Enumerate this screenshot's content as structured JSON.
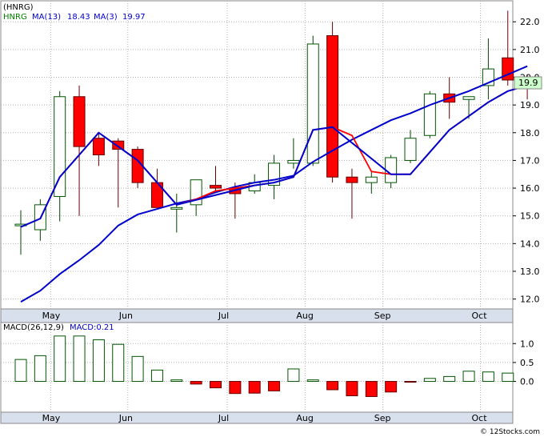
{
  "chart_data": [
    {
      "type": "candlestick",
      "title": "(HNRG)",
      "legend": [
        {
          "label": "HNRG",
          "color": "#008000"
        },
        {
          "label": "MA(13)",
          "value": "18.43",
          "color": "#0000cc"
        },
        {
          "label": "MA(3)",
          "value": "19.97",
          "color": "#0000cc"
        }
      ],
      "last_price_label": "19.9",
      "ylim": [
        11.7,
        22.7
      ],
      "yticks": [
        "12.0",
        "13.0",
        "14.0",
        "15.0",
        "16.0",
        "17.0",
        "18.0",
        "19.0",
        "20.0",
        "21.0",
        "22.0"
      ],
      "xticks": [
        "May",
        "Jun",
        "Jul",
        "Aug",
        "Sep",
        "Oct"
      ],
      "candles": [
        {
          "o": 14.7,
          "h": 15.2,
          "l": 13.6,
          "c": 14.7
        },
        {
          "o": 14.5,
          "h": 15.6,
          "l": 14.1,
          "c": 15.4
        },
        {
          "o": 15.7,
          "h": 19.5,
          "l": 14.8,
          "c": 19.3
        },
        {
          "o": 19.3,
          "h": 19.7,
          "l": 15.0,
          "c": 17.5
        },
        {
          "o": 17.8,
          "h": 18.0,
          "l": 16.8,
          "c": 17.2
        },
        {
          "o": 17.7,
          "h": 17.8,
          "l": 15.3,
          "c": 17.4
        },
        {
          "o": 17.4,
          "h": 17.5,
          "l": 16.0,
          "c": 16.2
        },
        {
          "o": 16.2,
          "h": 16.7,
          "l": 15.3,
          "c": 15.3
        },
        {
          "o": 15.3,
          "h": 15.8,
          "l": 14.4,
          "c": 15.3
        },
        {
          "o": 15.4,
          "h": 16.3,
          "l": 15.0,
          "c": 16.3
        },
        {
          "o": 16.1,
          "h": 16.8,
          "l": 15.9,
          "c": 16.0
        },
        {
          "o": 16.0,
          "h": 16.2,
          "l": 14.9,
          "c": 15.8
        },
        {
          "o": 15.9,
          "h": 16.5,
          "l": 15.8,
          "c": 16.2
        },
        {
          "o": 16.1,
          "h": 17.2,
          "l": 15.6,
          "c": 16.9
        },
        {
          "o": 16.9,
          "h": 17.8,
          "l": 16.7,
          "c": 17.0
        },
        {
          "o": 16.9,
          "h": 21.5,
          "l": 16.8,
          "c": 21.2
        },
        {
          "o": 21.5,
          "h": 22.0,
          "l": 16.2,
          "c": 16.4
        },
        {
          "o": 16.4,
          "h": 16.7,
          "l": 14.9,
          "c": 16.2
        },
        {
          "o": 16.2,
          "h": 16.6,
          "l": 15.8,
          "c": 16.4
        },
        {
          "o": 16.2,
          "h": 17.2,
          "l": 16.0,
          "c": 17.1
        },
        {
          "o": 17.0,
          "h": 18.1,
          "l": 16.9,
          "c": 17.8
        },
        {
          "o": 17.9,
          "h": 19.5,
          "l": 17.8,
          "c": 19.4
        },
        {
          "o": 19.4,
          "h": 20.0,
          "l": 18.5,
          "c": 19.1
        },
        {
          "o": 19.2,
          "h": 19.3,
          "l": 18.5,
          "c": 19.3
        },
        {
          "o": 19.7,
          "h": 21.4,
          "l": 19.2,
          "c": 20.3
        },
        {
          "o": 20.7,
          "h": 22.4,
          "l": 19.7,
          "c": 19.9
        },
        {
          "o": 20.0,
          "h": 20.1,
          "l": 19.2,
          "c": 19.9
        }
      ],
      "ma13": [
        11.9,
        12.3,
        12.9,
        13.4,
        13.95,
        14.65,
        15.05,
        15.25,
        15.45,
        15.6,
        15.85,
        16.05,
        16.2,
        16.3,
        16.45,
        16.95,
        17.35,
        17.75,
        18.1,
        18.45,
        18.7,
        19.0,
        19.25,
        19.5,
        19.8,
        20.1,
        20.4
      ],
      "ma13_comment": "blue long-term line values by bar index (visual estimate)",
      "ma3": [
        14.6,
        14.9,
        16.4,
        17.2,
        18.0,
        17.5,
        17.0,
        16.2,
        15.4,
        15.6,
        15.9,
        16.0,
        16.1,
        16.2,
        16.4,
        18.1,
        18.2,
        17.9,
        16.6,
        16.5,
        16.5,
        17.3,
        18.1,
        18.6,
        19.1,
        19.5,
        19.7
      ],
      "ma_short_red": [
        null,
        null,
        null,
        null,
        17.9,
        17.6,
        17.3,
        16.7,
        15.9,
        15.4,
        15.9,
        16.0,
        16.0,
        16.1,
        16.7,
        17.6,
        18.2,
        17.9,
        16.6,
        16.5,
        16.5
      ]
    },
    {
      "type": "bar",
      "title": "MACD(26,12,9)",
      "legend_value_label": "MACD:0.21",
      "ylim": [
        -0.75,
        1.45
      ],
      "yticks": [
        "1.0",
        "0.5",
        "0.0"
      ],
      "xticks": [
        "May",
        "Jun",
        "Jul",
        "Aug",
        "Sep",
        "Oct"
      ],
      "values": [
        0.58,
        0.68,
        1.2,
        1.2,
        1.1,
        0.98,
        0.66,
        0.3,
        0.04,
        -0.07,
        -0.17,
        -0.32,
        -0.31,
        -0.25,
        0.33,
        0.04,
        -0.22,
        -0.38,
        -0.4,
        -0.28,
        -0.02,
        0.08,
        0.13,
        0.27,
        0.25,
        0.22
      ]
    }
  ],
  "footer": {
    "text": "© 12Stocks.com"
  }
}
